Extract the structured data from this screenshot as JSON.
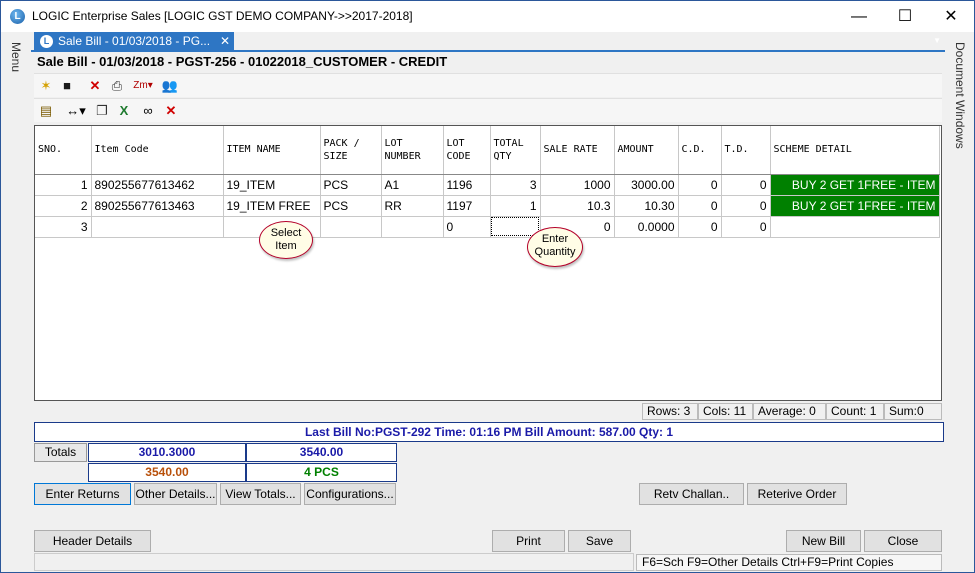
{
  "window": {
    "title": "LOGIC Enterprise Sales  [LOGIC GST DEMO COMPANY->>2017-2018]",
    "minimize": "—",
    "maximize": "☐",
    "close": "✕"
  },
  "side": {
    "left": "Menu",
    "right": "Document Windows"
  },
  "tab": {
    "label": "Sale Bill - 01/03/2018 - PG...",
    "close": "✕"
  },
  "document_title": "Sale Bill - 01/03/2018 - PGST-256 - 01022018_CUSTOMER - CREDIT",
  "grid": {
    "columns": [
      {
        "label": "SNO.",
        "width": 56
      },
      {
        "label": "Item Code",
        "width": 132
      },
      {
        "label": "ITEM NAME",
        "width": 97
      },
      {
        "label": "PACK /\nSIZE",
        "width": 61
      },
      {
        "label": "LOT\nNUMBER",
        "width": 62
      },
      {
        "label": "LOT\nCODE",
        "width": 47
      },
      {
        "label": "TOTAL\nQTY",
        "width": 50
      },
      {
        "label": "SALE RATE",
        "width": 74
      },
      {
        "label": "AMOUNT",
        "width": 64
      },
      {
        "label": "C.D.",
        "width": 43
      },
      {
        "label": "T.D.",
        "width": 49
      },
      {
        "label": "SCHEME DETAIL",
        "width": 169
      }
    ],
    "rows": [
      [
        "1",
        "890255677613462",
        "19_ITEM",
        "PCS",
        "A1",
        "1196",
        "3",
        "1000",
        "3000.00",
        "0",
        "0",
        "BUY 2 GET 1FREE - ITEM"
      ],
      [
        "2",
        "890255677613463",
        "19_ITEM FREE",
        "PCS",
        "RR",
        "1197",
        "1",
        "10.3",
        "10.30",
        "0",
        "0",
        "BUY 2 GET 1FREE - ITEM"
      ],
      [
        "3",
        "",
        "",
        "",
        "",
        "0",
        "",
        "0",
        "0.0000",
        "0",
        "0",
        ""
      ]
    ]
  },
  "callouts": {
    "select_item": "Select\nItem",
    "enter_quantity": "Enter\nQuantity"
  },
  "status": {
    "rows": "Rows: 3",
    "cols": "Cols: 11",
    "average": "Average: 0",
    "count": "Count: 1",
    "sum": "Sum:0"
  },
  "last_bill": "Last Bill No:PGST-292  Time: 01:16 PM   Bill Amount:  587.00  Qty:  1",
  "totals": {
    "label": "Totals",
    "value1": "3010.3000",
    "value2": "3540.00",
    "value3": "3540.00",
    "value4": "4 PCS",
    "colors": {
      "blue": "#1a1aa8",
      "orange": "#b8500a",
      "green": "#008000"
    }
  },
  "buttons": {
    "enter_returns": "Enter Returns",
    "other_details": "Other Details...",
    "view_totals": "View Totals...",
    "configurations": "Configurations...",
    "retv_challan": "Retv Challan..",
    "retrieve_order": "Reterive Order",
    "header_details": "Header Details",
    "print": "Print",
    "save": "Save",
    "new_bill": "New Bill",
    "close": "Close"
  },
  "hint": "F6=Sch  F9=Other Details  Ctrl+F9=Print Copies",
  "toolbar_icons": {
    "row1": [
      "new-icon",
      "save-icon",
      "delete-icon",
      "print-icon",
      "zoom-icon",
      "users-icon"
    ],
    "row2": [
      "calculator-icon",
      "column-width-icon",
      "copy-icon",
      "excel-icon",
      "find-icon",
      "clear-icon"
    ]
  }
}
